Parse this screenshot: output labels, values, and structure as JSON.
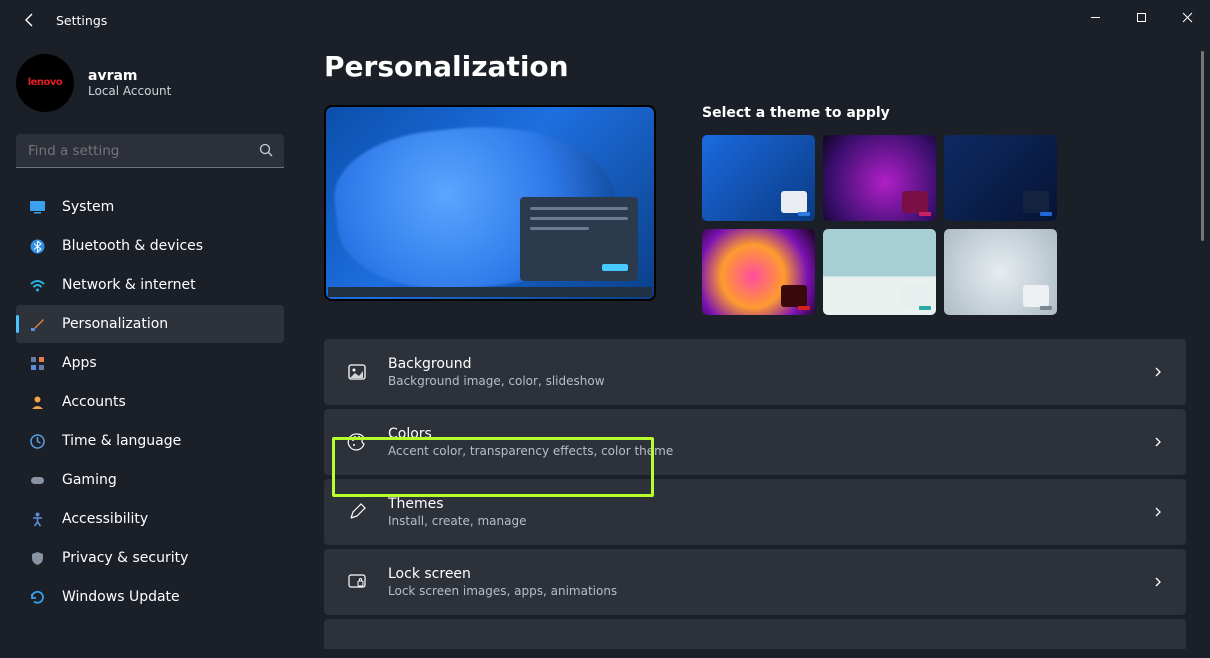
{
  "window": {
    "title": "Settings"
  },
  "user": {
    "name": "avram",
    "type": "Local Account",
    "avatar_brand": "lenovo"
  },
  "search": {
    "placeholder": "Find a setting"
  },
  "sidebar": {
    "items": [
      {
        "label": "System",
        "icon": "monitor-icon",
        "color": "#3aa0f0"
      },
      {
        "label": "Bluetooth & devices",
        "icon": "bluetooth-icon",
        "color": "#2d8fe6"
      },
      {
        "label": "Network & internet",
        "icon": "wifi-icon",
        "color": "#27b6e6"
      },
      {
        "label": "Personalization",
        "icon": "paintbrush-icon",
        "color": "#e27f4b",
        "active": true
      },
      {
        "label": "Apps",
        "icon": "apps-icon",
        "color": "#6a7aa8"
      },
      {
        "label": "Accounts",
        "icon": "person-icon",
        "color": "#f0a44b"
      },
      {
        "label": "Time & language",
        "icon": "clock-globe-icon",
        "color": "#5aa0e0"
      },
      {
        "label": "Gaming",
        "icon": "gamepad-icon",
        "color": "#8a93a3"
      },
      {
        "label": "Accessibility",
        "icon": "accessibility-icon",
        "color": "#5a8fe0"
      },
      {
        "label": "Privacy & security",
        "icon": "shield-icon",
        "color": "#8a93a3"
      },
      {
        "label": "Windows Update",
        "icon": "update-icon",
        "color": "#3aa0f0"
      }
    ]
  },
  "page": {
    "title": "Personalization",
    "themes_heading": "Select a theme to apply"
  },
  "settings_rows": [
    {
      "icon": "image-icon",
      "title": "Background",
      "subtitle": "Background image, color, slideshow"
    },
    {
      "icon": "palette-icon",
      "title": "Colors",
      "subtitle": "Accent color, transparency effects, color theme",
      "highlighted": true
    },
    {
      "icon": "pen-icon",
      "title": "Themes",
      "subtitle": "Install, create, manage"
    },
    {
      "icon": "lockscreen-icon",
      "title": "Lock screen",
      "subtitle": "Lock screen images, apps, animations"
    }
  ]
}
